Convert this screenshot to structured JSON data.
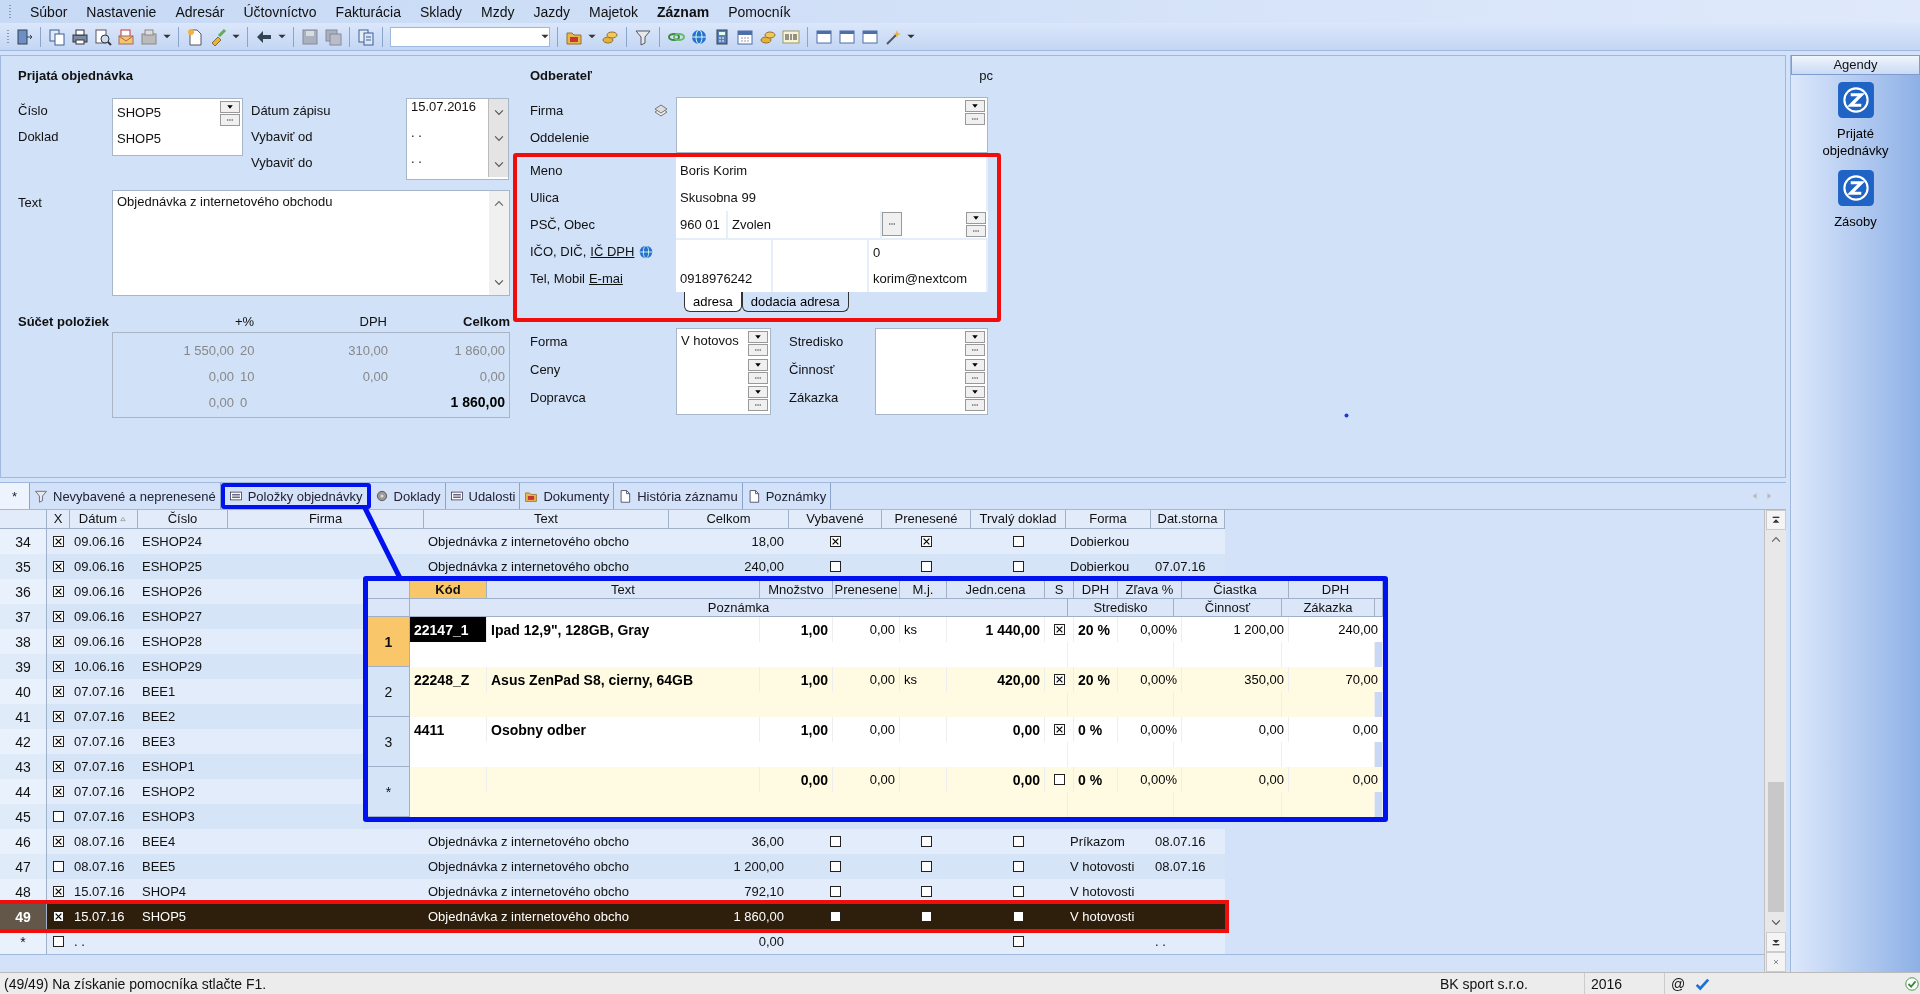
{
  "menu": [
    {
      "label": "Súbor",
      "highlighted": false
    },
    {
      "label": "Nastavenie",
      "highlighted": false
    },
    {
      "label": "Adresár",
      "highlighted": false
    },
    {
      "label": "Účtovníctvo",
      "highlighted": false
    },
    {
      "label": "Fakturácia",
      "highlighted": false
    },
    {
      "label": "Sklady",
      "highlighted": false
    },
    {
      "label": "Mzdy",
      "highlighted": false
    },
    {
      "label": "Jazdy",
      "highlighted": false
    },
    {
      "label": "Majetok",
      "highlighted": false
    },
    {
      "label": "Záznam",
      "highlighted": true
    },
    {
      "label": "Pomocník",
      "highlighted": false
    }
  ],
  "order": {
    "title": "Prijatá objednávka",
    "fields": [
      {
        "label": "Číslo",
        "value": "SHOP5"
      },
      {
        "label": "Doklad",
        "value": "SHOP5"
      }
    ],
    "dates": [
      {
        "label": "Dátum zápisu",
        "value": "15.07.2016"
      },
      {
        "label": "Vybaviť od",
        "value": ". ."
      },
      {
        "label": "Vybaviť do",
        "value": ". ."
      }
    ],
    "text_label": "Text",
    "text_value": "Objednávka z internetového obchodu",
    "sums": {
      "title": "Súčet položiek",
      "columns": [
        "+%",
        "DPH",
        "Celkom"
      ],
      "rows": [
        {
          "base": "1 550,00",
          "pct": "20",
          "vat": "310,00",
          "total": "1 860,00",
          "emphasized": false
        },
        {
          "base": "0,00",
          "pct": "10",
          "vat": "0,00",
          "total": "0,00",
          "emphasized": false
        },
        {
          "base": "0,00",
          "pct": "0",
          "total": "1 860,00",
          "emphasized": true
        }
      ]
    }
  },
  "customer": {
    "title": "Odberateľ",
    "code": "pc",
    "firma_label": "Firma",
    "oddelenie_label": "Oddelenie",
    "highlighted": true,
    "labels": {
      "meno": "Meno",
      "ulica": "Ulica",
      "psc": "PSČ, Obec",
      "ico": "IČO, DIČ,",
      "ic_dph_link": "IČ DPH",
      "tel": "Tel, Mobil",
      "email_link": "E-mai"
    },
    "meno": "Boris Korim",
    "ulica": "Skusobna 99",
    "psc": "960 01",
    "obec": "Zvolen",
    "ic_dph": "0",
    "phone": "0918976242",
    "email": "korim@nextcom",
    "address_tabs": [
      {
        "label": "adresa",
        "selected": true
      },
      {
        "label": "dodacia adresa",
        "selected": false
      }
    ],
    "payment_labels": [
      "Forma",
      "Ceny",
      "Dopravca"
    ],
    "forma": "V hotovos",
    "assignment_labels": [
      "Stredisko",
      "Činnosť",
      "Zákazka"
    ]
  },
  "agendy": {
    "title": "Agendy",
    "items": [
      {
        "label": "Prijaté objednávky"
      },
      {
        "label": "Zásoby"
      }
    ]
  },
  "tabs": [
    {
      "label": "*",
      "selected": true,
      "highlighted": false
    },
    {
      "label": "Nevybavené a neprenesené",
      "selected": false,
      "highlighted": false
    },
    {
      "label": "Položky objednávky",
      "selected": false,
      "highlighted": true
    },
    {
      "label": "Doklady",
      "selected": false,
      "highlighted": false
    },
    {
      "label": "Udalosti",
      "selected": false,
      "highlighted": false
    },
    {
      "label": "Dokumenty",
      "selected": false,
      "highlighted": false
    },
    {
      "label": "História záznamu",
      "selected": false,
      "highlighted": false
    },
    {
      "label": "Poznámky",
      "selected": false,
      "highlighted": false
    }
  ],
  "table": {
    "columns": [
      {
        "label": "X",
        "sorted": false
      },
      {
        "label": "Dátum",
        "sorted": true
      },
      {
        "label": "Číslo",
        "sorted": false
      },
      {
        "label": "Firma",
        "sorted": false
      },
      {
        "label": "Text",
        "sorted": false
      },
      {
        "label": "Celkom",
        "sorted": false
      },
      {
        "label": "Vybavené",
        "sorted": false
      },
      {
        "label": "Prenesené",
        "sorted": false
      },
      {
        "label": "Trvalý doklad",
        "sorted": false
      },
      {
        "label": "Forma",
        "sorted": false
      },
      {
        "label": "Dat.storna",
        "sorted": false
      }
    ],
    "rows": [
      {
        "num": "34",
        "x": true,
        "date": "09.06.16",
        "number": "ESHOP24",
        "text": "Objednávka z internetového obcho",
        "total": "18,00",
        "done": true,
        "transferred": true,
        "permanent": false,
        "payment": "Dobierkou",
        "selected": false,
        "highlighted": false
      },
      {
        "num": "35",
        "x": true,
        "date": "09.06.16",
        "number": "ESHOP25",
        "text": "Objednávka z internetového obcho",
        "total": "240,00",
        "done": false,
        "transferred": false,
        "permanent": false,
        "payment": "Dobierkou",
        "storno": "07.07.16",
        "selected": false,
        "highlighted": false
      },
      {
        "num": "36",
        "x": true,
        "date": "09.06.16",
        "number": "ESHOP26",
        "selected": false,
        "highlighted": false
      },
      {
        "num": "37",
        "x": true,
        "date": "09.06.16",
        "number": "ESHOP27",
        "selected": false,
        "highlighted": false
      },
      {
        "num": "38",
        "x": true,
        "date": "09.06.16",
        "number": "ESHOP28",
        "selected": false,
        "highlighted": false
      },
      {
        "num": "39",
        "x": true,
        "date": "10.06.16",
        "number": "ESHOP29",
        "selected": false,
        "highlighted": false
      },
      {
        "num": "40",
        "x": true,
        "date": "07.07.16",
        "number": "BEE1",
        "selected": false,
        "highlighted": false
      },
      {
        "num": "41",
        "x": true,
        "date": "07.07.16",
        "number": "BEE2",
        "selected": false,
        "highlighted": false
      },
      {
        "num": "42",
        "x": true,
        "date": "07.07.16",
        "number": "BEE3",
        "selected": false,
        "highlighted": false
      },
      {
        "num": "43",
        "x": true,
        "date": "07.07.16",
        "number": "ESHOP1",
        "selected": false,
        "highlighted": false
      },
      {
        "num": "44",
        "x": true,
        "date": "07.07.16",
        "number": "ESHOP2",
        "selected": false,
        "highlighted": false
      },
      {
        "num": "45",
        "x": false,
        "date": "07.07.16",
        "number": "ESHOP3",
        "selected": false,
        "highlighted": false
      },
      {
        "num": "46",
        "x": true,
        "date": "08.07.16",
        "number": "BEE4",
        "text": "Objednávka z internetového obcho",
        "total": "36,00",
        "done": false,
        "transferred": false,
        "permanent": false,
        "payment": "Príkazom",
        "storno": "08.07.16",
        "selected": false,
        "highlighted": false
      },
      {
        "num": "47",
        "x": false,
        "date": "08.07.16",
        "number": "BEE5",
        "text": "Objednávka z internetového obcho",
        "total": "1 200,00",
        "done": false,
        "transferred": false,
        "permanent": false,
        "payment": "V hotovosti",
        "storno": "08.07.16",
        "selected": false,
        "highlighted": false
      },
      {
        "num": "48",
        "x": true,
        "date": "15.07.16",
        "number": "SHOP4",
        "text": "Objednávka z internetového obcho",
        "total": "792,10",
        "done": false,
        "transferred": false,
        "permanent": false,
        "payment": "V hotovosti",
        "selected": false,
        "highlighted": false
      },
      {
        "num": "49",
        "x": true,
        "date": "15.07.16",
        "number": "SHOP5",
        "text": "Objednávka z internetového obcho",
        "total": "1 860,00",
        "done": false,
        "transferred": false,
        "permanent": false,
        "payment": "V hotovosti",
        "selected": true,
        "highlighted": true
      },
      {
        "num": "*",
        "x": false,
        "date": ". .",
        "total": "0,00",
        "permanent": false,
        "storno": ". .",
        "selected": false,
        "highlighted": false
      }
    ]
  },
  "items": {
    "highlighted": true,
    "columns": [
      {
        "label": "Kód",
        "active": true
      },
      {
        "label": "Text",
        "active": false
      },
      {
        "label": "Množstvo",
        "active": false
      },
      {
        "label": "Prenesene",
        "active": false
      },
      {
        "label": "M.j.",
        "active": false
      },
      {
        "label": "Jedn.cena",
        "active": false
      },
      {
        "label": "S",
        "active": false
      },
      {
        "label": "DPH",
        "active": false
      },
      {
        "label": "Zľava %",
        "active": false
      },
      {
        "label": "Čiastka",
        "active": false
      },
      {
        "label": "DPH",
        "active": false
      }
    ],
    "subcolumns": [
      "Poznámka",
      "Stredisko",
      "Činnosť",
      "Zákazka"
    ],
    "rows": [
      {
        "num": "1",
        "selected": true,
        "code": "22147_1",
        "text": "Ipad 12,9\", 128GB, Gray",
        "qty": "1,00",
        "moved": "0,00",
        "unit": "ks",
        "price": "1 440,00",
        "s": true,
        "vat": "20 %",
        "discount": "0,00%",
        "amount": "1 200,00",
        "vat_amount": "240,00"
      },
      {
        "num": "2",
        "selected": false,
        "code": "22248_Z",
        "text": "Asus ZenPad S8, cierny, 64GB",
        "qty": "1,00",
        "moved": "0,00",
        "unit": "ks",
        "price": "420,00",
        "s": true,
        "vat": "20 %",
        "discount": "0,00%",
        "amount": "350,00",
        "vat_amount": "70,00"
      },
      {
        "num": "3",
        "selected": false,
        "code": "4411",
        "text": "Osobny odber",
        "qty": "1,00",
        "moved": "0,00",
        "price": "0,00",
        "s": true,
        "vat": "0 %",
        "discount": "0,00%",
        "amount": "0,00",
        "vat_amount": "0,00"
      },
      {
        "num": "*",
        "selected": false,
        "qty": "0,00",
        "moved": "0,00",
        "price": "0,00",
        "s": false,
        "vat": "0 %",
        "discount": "0,00%",
        "amount": "0,00",
        "vat_amount": "0,00"
      }
    ]
  },
  "status": {
    "message": "(49/49) Na získanie pomocníka stlačte F1.",
    "company": "BK sport  s.r.o.",
    "year": "2016",
    "at": "@"
  }
}
